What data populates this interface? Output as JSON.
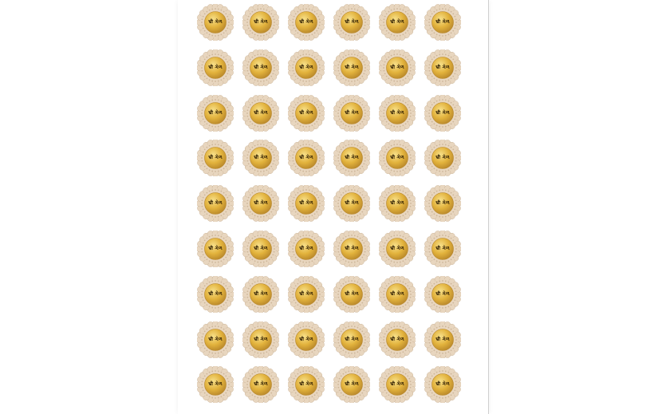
{
  "sheet": {
    "rows": 9,
    "columns": 6,
    "sticker_text": "भ्री ગેળ",
    "colors": {
      "gold_light": "#f7e08a",
      "gold_mid": "#e2b23c",
      "gold_dark": "#b7862a",
      "lace": "#e8d6bf",
      "lace_edge": "#cdb69a",
      "text": "#2a1a00"
    },
    "icons": [
      "gold-lace-sticker-icon"
    ]
  }
}
